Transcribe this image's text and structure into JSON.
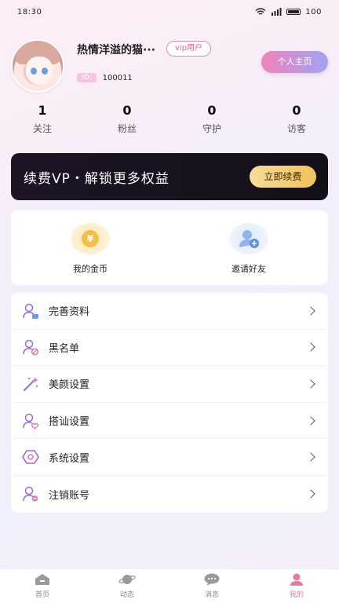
{
  "status": {
    "time": "18:30",
    "battery": "100"
  },
  "profile": {
    "nickname": "热情洋溢的猫···",
    "vip_badge": "vip用户",
    "id_tag": "ID:",
    "id_value": "100011",
    "home_button": "个人主页"
  },
  "stats": [
    {
      "num": "1",
      "label": "关注"
    },
    {
      "num": "0",
      "label": "粉丝"
    },
    {
      "num": "0",
      "label": "守护"
    },
    {
      "num": "0",
      "label": "访客"
    }
  ],
  "vip_banner": {
    "text": "续费VP・解锁更多权益",
    "button": "立即续费"
  },
  "quick": [
    {
      "label": "我的金币",
      "icon": "coin-icon"
    },
    {
      "label": "邀请好友",
      "icon": "invite-friend-icon"
    }
  ],
  "menu": [
    {
      "label": "完善资料",
      "icon": "profile-edit-icon"
    },
    {
      "label": "黑名单",
      "icon": "blacklist-icon"
    },
    {
      "label": "美颜设置",
      "icon": "magic-wand-icon"
    },
    {
      "label": "搭讪设置",
      "icon": "greet-heart-icon"
    },
    {
      "label": "系统设置",
      "icon": "hexagon-settings-icon"
    },
    {
      "label": "注销账号",
      "icon": "cancel-account-icon"
    }
  ],
  "tabs": [
    {
      "label": "首页",
      "icon": "home-icon"
    },
    {
      "label": "动态",
      "icon": "planet-icon"
    },
    {
      "label": "消息",
      "icon": "chat-bubble-icon"
    },
    {
      "label": "我的",
      "icon": "user-icon"
    }
  ],
  "colors": {
    "accent": "#e37aa9",
    "banner": "#141018",
    "gold": "#f2c25c"
  }
}
